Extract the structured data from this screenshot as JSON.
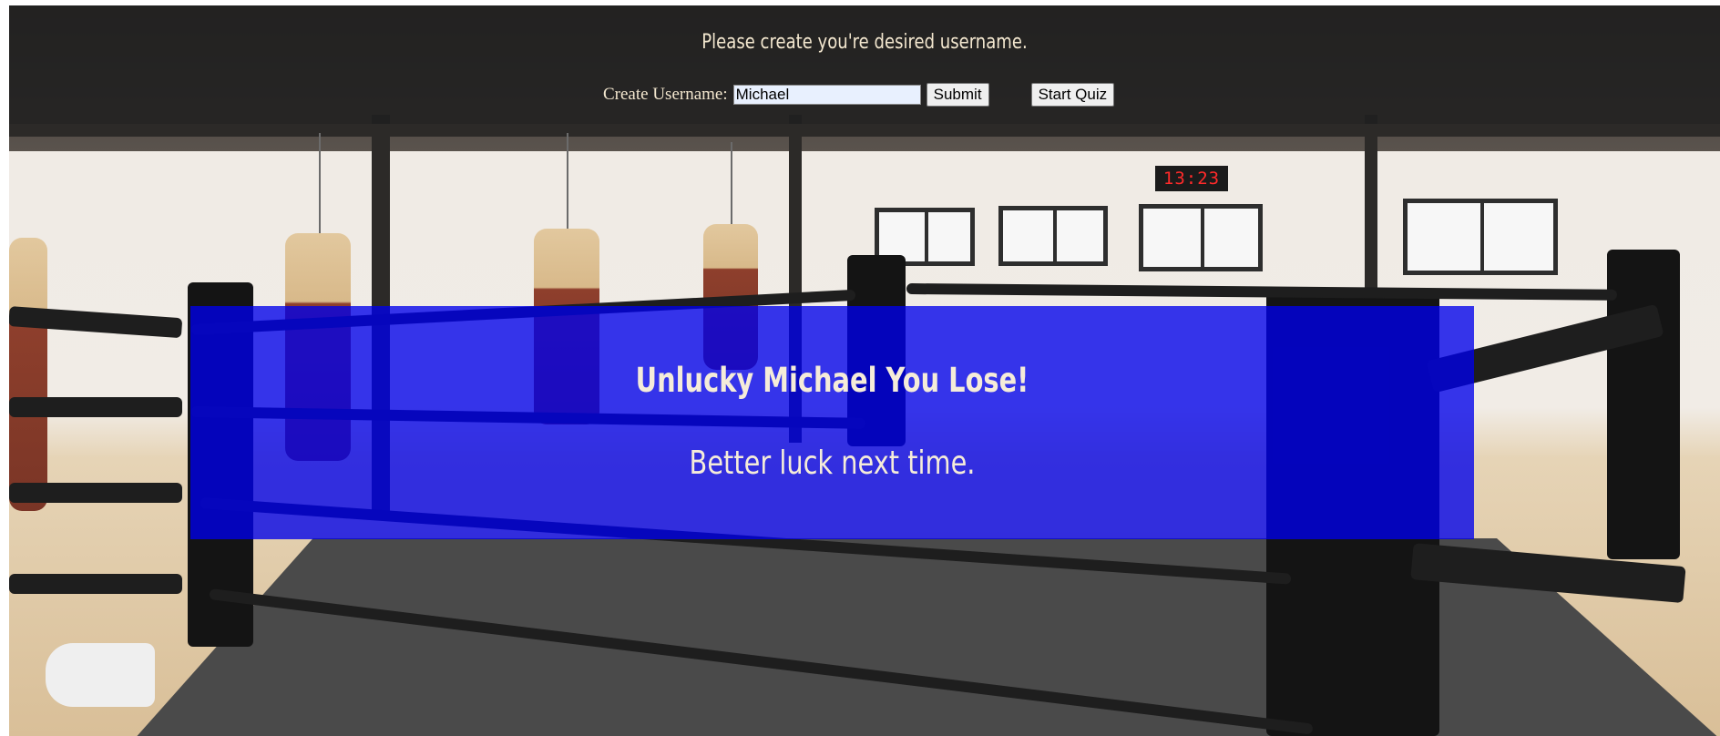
{
  "header": {
    "title": "Please create you're desired username.",
    "username_label": "Create Username:",
    "username_value": "Michael",
    "submit_label": "Submit",
    "start_label": "Start Quiz"
  },
  "result": {
    "heading": "Unlucky Michael You Lose!",
    "message": "Better luck next time."
  },
  "background": {
    "clock_text": "13:23"
  },
  "colors": {
    "header_bg": "#1e1e1e",
    "header_text": "#f3e7cf",
    "panel_bg": "#0000eb",
    "clock_digits": "#ff2a2a"
  }
}
